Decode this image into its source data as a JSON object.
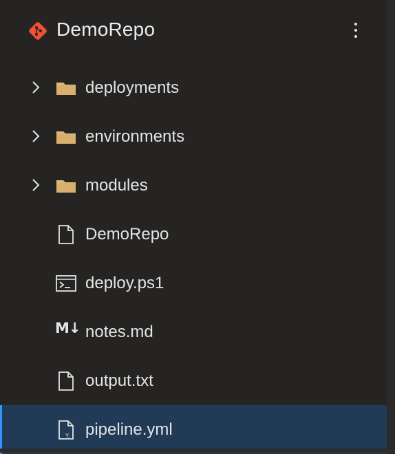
{
  "repo": {
    "title": "DemoRepo",
    "icon": "git-diamond-icon",
    "accent": "#f05133"
  },
  "colors": {
    "background": "#252423",
    "folder": "#dcb67a",
    "selected_row": "#213a56",
    "selected_border": "#3794ff",
    "text": "#e4e4e4"
  },
  "tree": {
    "items": [
      {
        "label": "deployments",
        "type": "folder",
        "icon": "folder-icon",
        "expandable": true
      },
      {
        "label": "environments",
        "type": "folder",
        "icon": "folder-icon",
        "expandable": true
      },
      {
        "label": "modules",
        "type": "folder",
        "icon": "folder-icon",
        "expandable": true
      },
      {
        "label": "DemoRepo",
        "type": "file",
        "icon": "file-icon"
      },
      {
        "label": "deploy.ps1",
        "type": "file",
        "icon": "powershell-icon"
      },
      {
        "label": "notes.md",
        "type": "file",
        "icon": "markdown-icon",
        "icon_text": "M↓"
      },
      {
        "label": "output.txt",
        "type": "file",
        "icon": "file-icon"
      },
      {
        "label": "pipeline.yml",
        "type": "file",
        "icon": "yaml-file-icon",
        "selected": true
      }
    ]
  }
}
